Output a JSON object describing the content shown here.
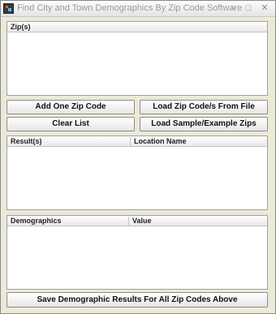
{
  "window": {
    "title": "Find City and Town Demographics By Zip Code Software",
    "min_glyph": "–",
    "max_glyph": "□",
    "close_glyph": "✕"
  },
  "zips": {
    "header": "Zip(s)"
  },
  "buttons": {
    "add_one": "Add One Zip Code",
    "load_file": "Load Zip Code/s From File",
    "clear_list": "Clear List",
    "load_sample": "Load Sample/Example Zips",
    "save_results": "Save Demographic Results For All Zip Codes Above"
  },
  "results": {
    "columns": [
      "Result(s)",
      "Location Name"
    ]
  },
  "demographics": {
    "columns": [
      "Demographics",
      "Value"
    ]
  }
}
